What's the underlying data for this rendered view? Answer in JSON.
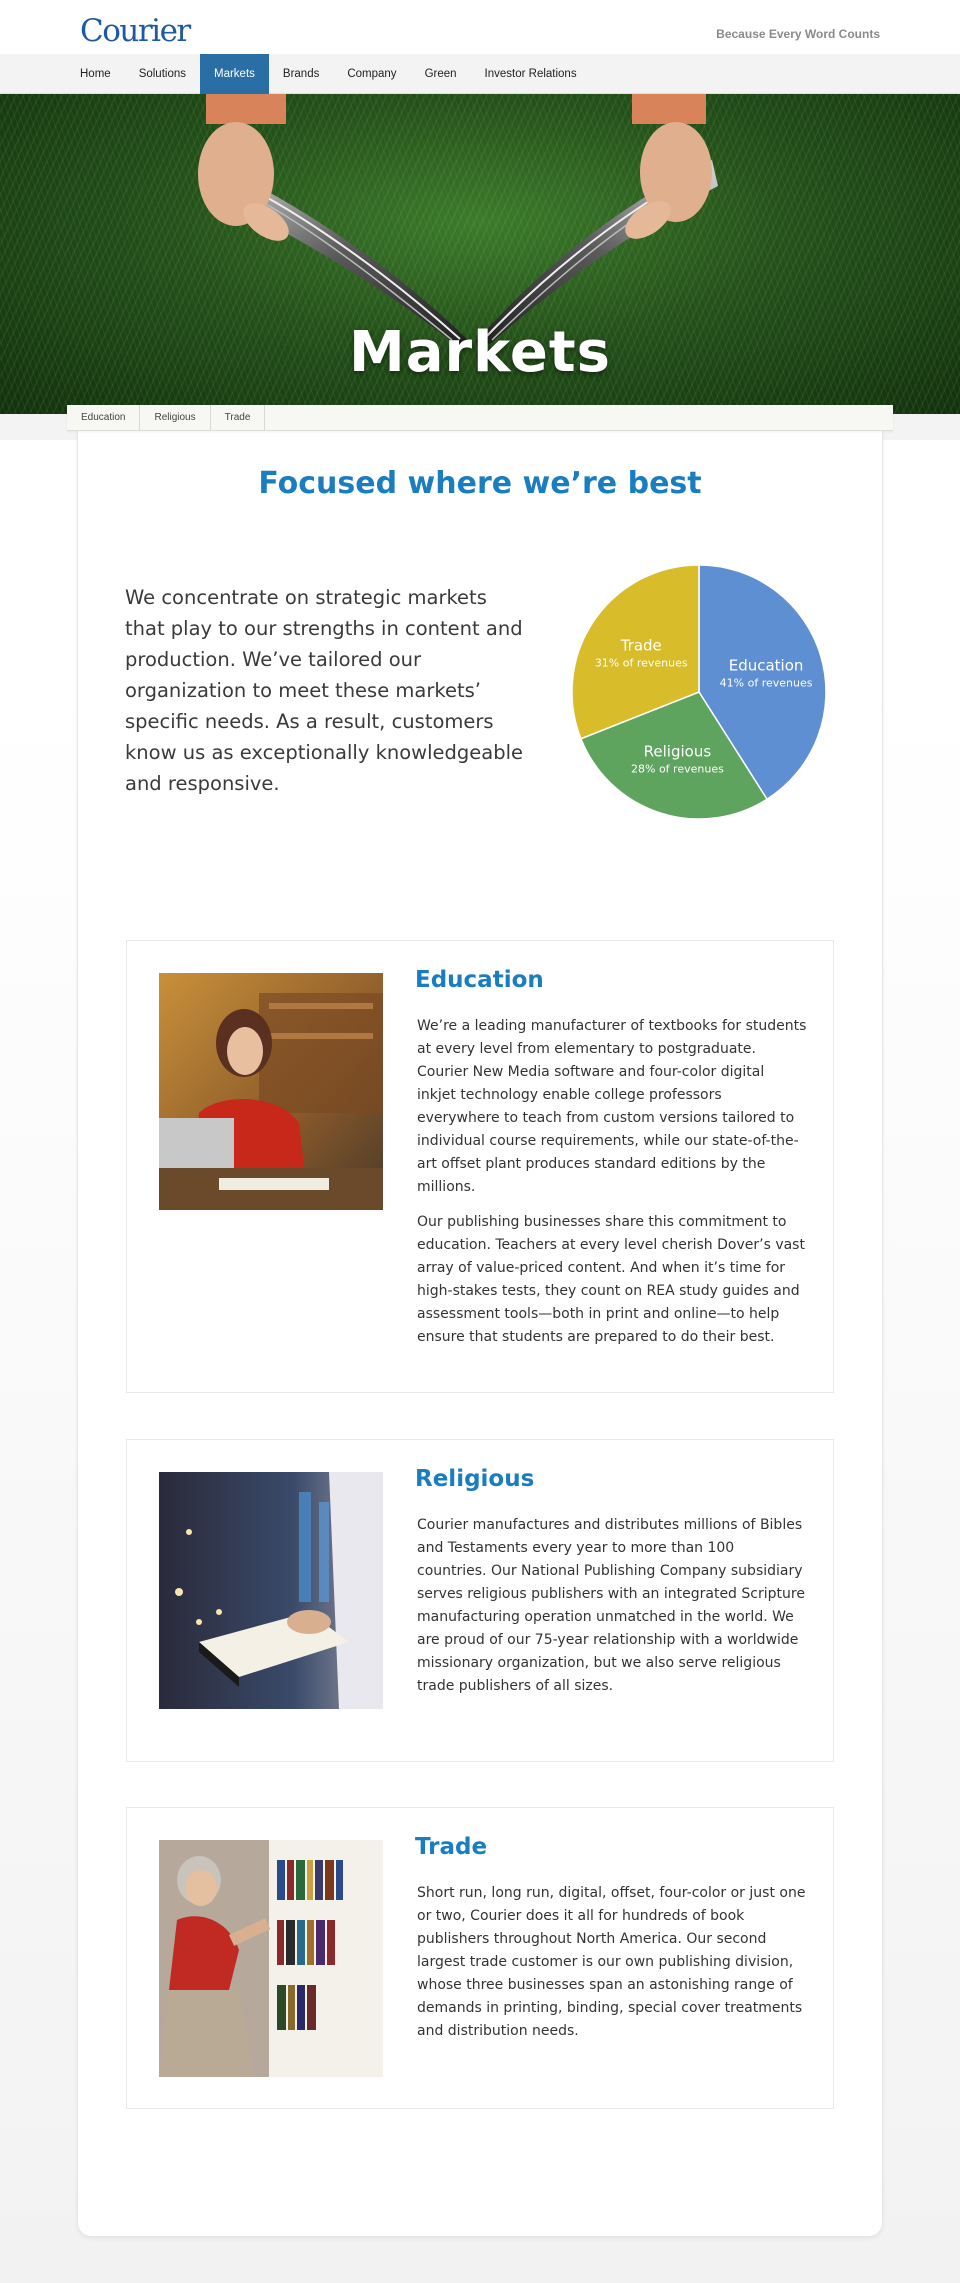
{
  "header": {
    "logo": "Courier",
    "tagline": "Because Every Word Counts"
  },
  "nav": {
    "items": [
      "Home",
      "Solutions",
      "Markets",
      "Brands",
      "Company",
      "Green",
      "Investor Relations"
    ],
    "active": "Markets"
  },
  "hero": {
    "title": "Markets"
  },
  "subnav": {
    "items": [
      "Education",
      "Religious",
      "Trade"
    ]
  },
  "headline": "Focused where we’re best",
  "intro": "We concentrate on strategic markets that play to our strengths in content and production. We’ve tailored our organization to meet these markets’ specific needs. As a result, customers know us as exceptionally knowledgeable and responsive.",
  "chart_data": {
    "type": "pie",
    "categories": [
      "Education",
      "Religious",
      "Trade"
    ],
    "values": [
      41,
      28,
      31
    ],
    "labels": [
      "41% of revenues",
      "28% of revenues",
      "31% of revenues"
    ],
    "colors": [
      "#5f8fd3",
      "#5ea35e",
      "#d8bc2a"
    ]
  },
  "sections": [
    {
      "title": "Education",
      "paragraphs": [
        "We’re a leading manufacturer of textbooks for students at every level from elementary to postgraduate. Courier New Media software and four-color digital inkjet technology enable college professors everywhere to teach from custom versions tailored to individual course requirements, while our state-of-the-art offset plant produces standard editions by the millions.",
        "Our publishing businesses share this commitment to education. Teachers at every level cherish Dover’s vast array of value-priced content. And when it’s time for high-stakes tests, they count on REA study guides and assessment tools—both in print and online—to help ensure that students are prepared to do their best."
      ]
    },
    {
      "title": "Religious",
      "paragraphs": [
        "Courier manufactures and distributes millions of Bibles and Testaments every year to more than 100 countries. Our National Publishing Company subsidiary serves religious publishers with an integrated Scripture manufacturing operation unmatched in the world. We are proud of our 75-year relationship with a worldwide missionary organization, but we also serve religious trade publishers of all sizes."
      ]
    },
    {
      "title": "Trade",
      "paragraphs": [
        "Short run, long run, digital, offset, four-color or just one or two, Courier does it all for hundreds of book publishers throughout North America. Our second largest trade customer is our own publishing division, whose three businesses span an astonishing range of demands in printing, binding, special cover treatments and distribution needs."
      ]
    }
  ]
}
